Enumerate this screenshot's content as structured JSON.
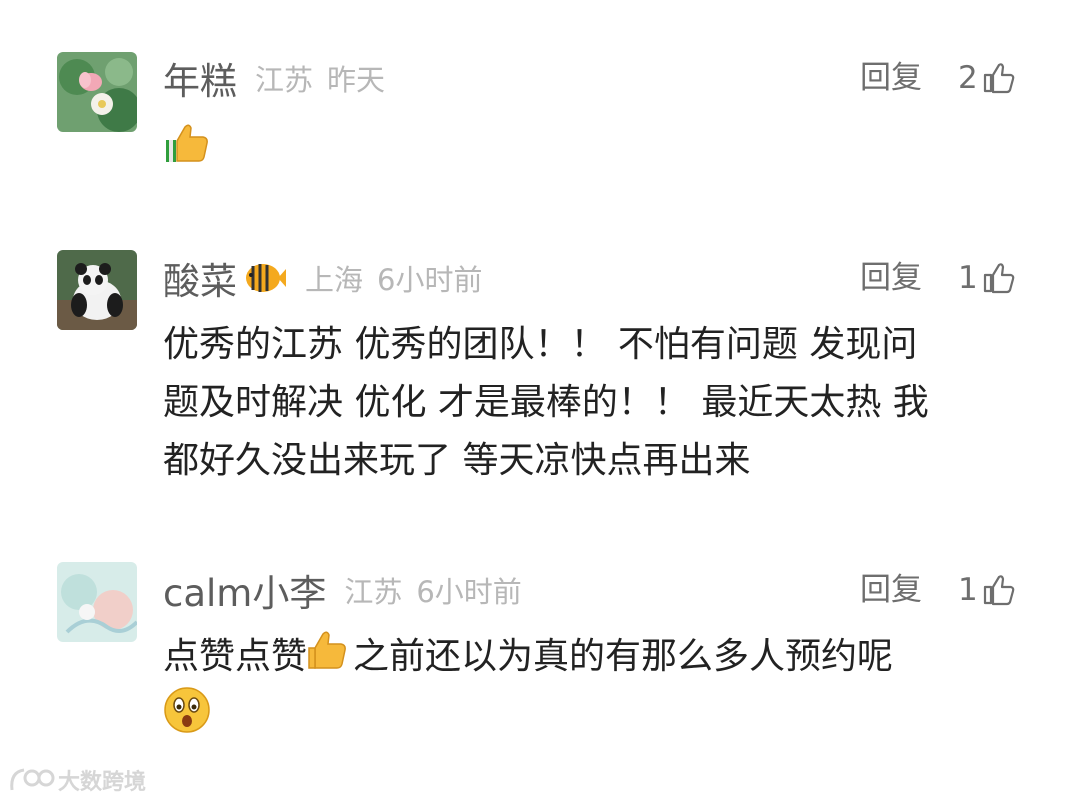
{
  "comments": [
    {
      "username": "年糕",
      "location": "江苏",
      "time": "昨天",
      "reply_label": "回复",
      "like_count": "2",
      "text": "",
      "avatar": "lotus-flower-avatar"
    },
    {
      "username": "酸菜",
      "location": "上海",
      "time": "6小时前",
      "reply_label": "回复",
      "like_count": "1",
      "text_lines": [
        "优秀的江苏 优秀的团队！！ 不怕有问题 发现问",
        "题及时解决 优化 才是最棒的！！  最近天太热 我",
        "都好久没出来玩了 等天凉快点再出来"
      ],
      "avatar": "panda-avatar",
      "badge": "fish-badge"
    },
    {
      "username": "calm小李",
      "location": "江苏",
      "time": "6小时前",
      "reply_label": "回复",
      "like_count": "1",
      "text_a": "点赞点赞",
      "text_b": "之前还以为真的有那么多人预约呢",
      "avatar": "illustration-avatar"
    }
  ],
  "watermark": "大数跨境",
  "colors": {
    "name": "#5d5d5d",
    "meta": "#b7b7b7",
    "text": "#222222"
  }
}
